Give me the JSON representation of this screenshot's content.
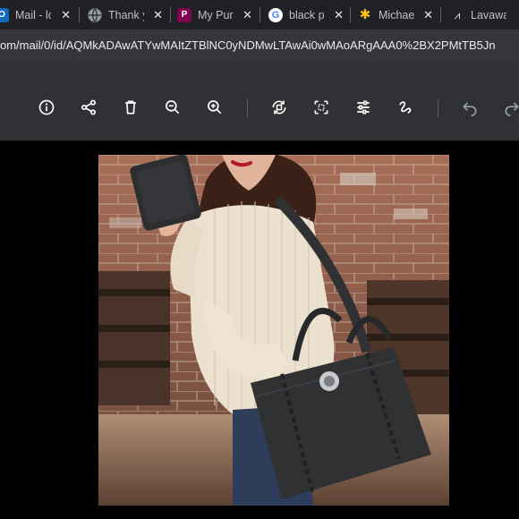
{
  "tabs": [
    {
      "label": "Mail - lo",
      "icon": "outlook-icon",
      "color": "#0f6cbd"
    },
    {
      "label": "Thank y",
      "icon": "globe-icon",
      "color": "#8ab4f8"
    },
    {
      "label": "My Pur",
      "icon": "poshmark-icon",
      "color": "#7f0353"
    },
    {
      "label": "black p",
      "icon": "google-icon",
      "color": "#ffffff"
    },
    {
      "label": "Michae",
      "icon": "walmart-icon",
      "color": "#ffc220"
    },
    {
      "label": "Lavawa",
      "icon": "lavawa-icon",
      "color": "#202124"
    }
  ],
  "address": {
    "url": "om/mail/0/id/AQMkADAwATYwMAItZTBlNC0yNDMwLTAwAi0wMAoARgAAA0%2BX2PMtTB5Jn"
  },
  "toolbar": {
    "buttons": [
      "info-icon",
      "share-icon",
      "delete-icon",
      "zoom-out-icon",
      "zoom-in-icon",
      "rotate-icon",
      "crop-icon",
      "adjust-icon",
      "markup-icon",
      "undo-icon",
      "redo-icon"
    ]
  },
  "image": {
    "subject": "Photo of a woman in a cream knit sweater carrying a dark grey tote bag",
    "accent": "#2f3133"
  }
}
